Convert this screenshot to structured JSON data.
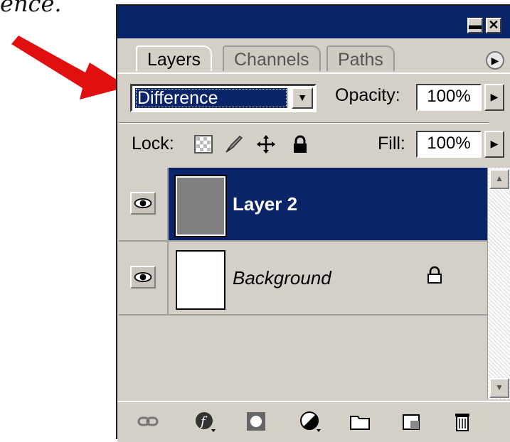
{
  "caption_fragment": "ence.",
  "panel": {
    "tabs": [
      {
        "label": "Layers",
        "active": true
      },
      {
        "label": "Channels",
        "active": false
      },
      {
        "label": "Paths",
        "active": false
      }
    ],
    "blend_mode": "Difference",
    "opacity_label": "Opacity:",
    "opacity_value": "100%",
    "lock_label": "Lock:",
    "fill_label": "Fill:",
    "fill_value": "100%",
    "layers": [
      {
        "name": "Layer 2",
        "selected": true,
        "visible": true,
        "thumb_color": "#808080",
        "locked": false
      },
      {
        "name": "Background",
        "selected": false,
        "visible": true,
        "thumb_color": "#ffffff",
        "locked": true
      }
    ],
    "bottom_icons": [
      "link-icon",
      "layer-style-icon",
      "mask-icon",
      "adjustment-layer-icon",
      "new-group-icon",
      "new-layer-icon",
      "trash-icon"
    ],
    "lock_icons": [
      "lock-transparency-icon",
      "lock-image-icon",
      "lock-position-icon",
      "lock-all-icon"
    ]
  },
  "colors": {
    "title_bar": "#0a246a",
    "selection": "#0a246a",
    "panel_bg": "#d4d0c8",
    "arrow": "#e01010"
  }
}
